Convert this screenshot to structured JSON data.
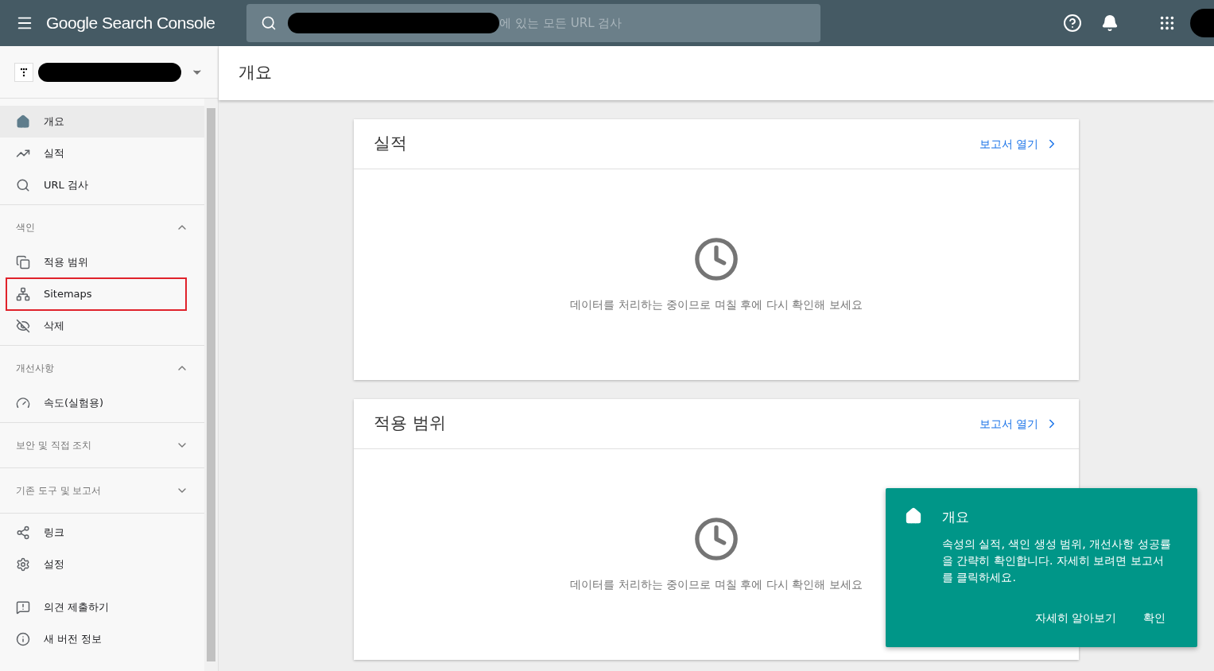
{
  "header": {
    "title": "Google Search Console",
    "search": {
      "placeholder": "에 있는 모든 URL 검사"
    }
  },
  "sidebar": {
    "groups": [
      {
        "items": [
          {
            "label": "개요",
            "selected": true,
            "highlighted": false
          },
          {
            "label": "실적",
            "selected": false,
            "highlighted": false
          },
          {
            "label": "URL 검사",
            "selected": false,
            "highlighted": false
          }
        ]
      },
      {
        "label": "색인",
        "expanded": true,
        "items": [
          {
            "label": "적용 범위",
            "selected": false,
            "highlighted": false
          },
          {
            "label": "Sitemaps",
            "selected": false,
            "highlighted": true
          },
          {
            "label": "삭제",
            "selected": false,
            "highlighted": false
          }
        ]
      },
      {
        "label": "개선사항",
        "expanded": true,
        "items": [
          {
            "label": "속도(실험용)",
            "selected": false,
            "highlighted": false
          }
        ]
      },
      {
        "label": "보안 및 직접 조치",
        "expanded": false
      },
      {
        "label": "기존 도구 및 보고서",
        "expanded": false
      },
      {
        "items": [
          {
            "label": "링크",
            "selected": false,
            "highlighted": false
          },
          {
            "label": "설정",
            "selected": false,
            "highlighted": false
          }
        ]
      },
      {
        "items": [
          {
            "label": "의견 제출하기",
            "selected": false,
            "highlighted": false
          },
          {
            "label": "새 버전 정보",
            "selected": false,
            "highlighted": false
          }
        ]
      }
    ]
  },
  "page_title": "개요",
  "cards": [
    {
      "title": "실적",
      "link": "보고서 열기",
      "message": "데이터를 처리하는 중이므로 며칠 후에 다시 확인해 보세요"
    },
    {
      "title": "적용 범위",
      "link": "보고서 열기",
      "message": "데이터를 처리하는 중이므로 며칠 후에 다시 확인해 보세요"
    }
  ],
  "tooltip": {
    "title": "개요",
    "body": "속성의 실적, 색인 생성 범위, 개선사항 성공률을 간략히 확인합니다. 자세히 보려면 보고서를 클릭하세요.",
    "buttons": [
      "자세히 알아보기",
      "확인"
    ]
  }
}
